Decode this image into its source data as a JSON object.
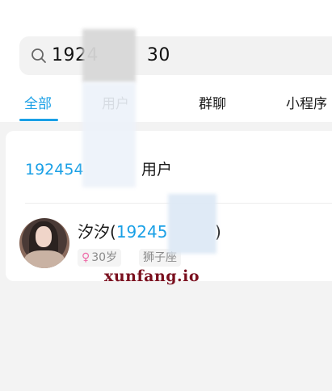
{
  "search": {
    "icon": "search-icon",
    "value": "1924        30"
  },
  "tabs": [
    {
      "label": "全部",
      "active": true
    },
    {
      "label": "用户",
      "active": false
    },
    {
      "label": "群聊",
      "active": false
    },
    {
      "label": "小程序",
      "active": false
    }
  ],
  "user_result": {
    "number_prefix": "192454",
    "suffix": "用户"
  },
  "contact": {
    "name": "汐汐",
    "open_paren": "(",
    "number_prefix": "19245",
    "close_paren": ")",
    "tags": [
      {
        "icon": "female-icon",
        "symbol": "♀",
        "label": "30岁"
      },
      {
        "label": "狮子座"
      }
    ]
  },
  "watermark": "xunfang.io",
  "colors": {
    "accent": "#1aa0e6",
    "female": "#ee6aa8",
    "watermark": "#7a0f1e"
  }
}
